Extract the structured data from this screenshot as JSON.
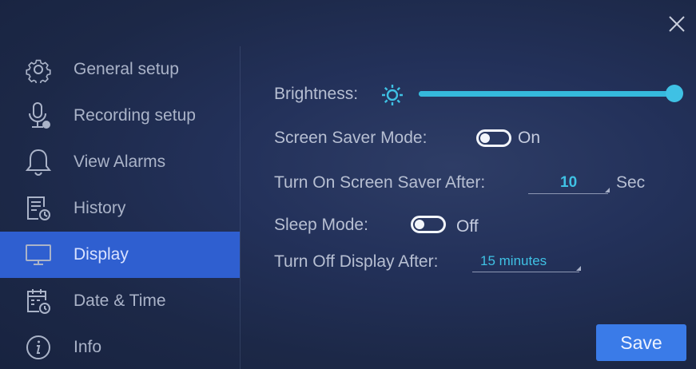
{
  "sidebar": {
    "items": [
      {
        "label": "General setup",
        "icon": "gear-icon"
      },
      {
        "label": "Recording setup",
        "icon": "microphone-icon"
      },
      {
        "label": "View Alarms",
        "icon": "bell-icon"
      },
      {
        "label": "History",
        "icon": "history-icon"
      },
      {
        "label": "Display",
        "icon": "monitor-icon",
        "active": true
      },
      {
        "label": "Date & Time",
        "icon": "calendar-clock-icon"
      },
      {
        "label": "Info",
        "icon": "info-icon"
      }
    ]
  },
  "display": {
    "brightness_label": "Brightness:",
    "brightness_level_percent": 100,
    "screen_saver_label": "Screen Saver Mode:",
    "screen_saver_state": "On",
    "screen_saver_after_label": "Turn On Screen Saver After:",
    "screen_saver_after_value": "10",
    "screen_saver_after_unit": "Sec",
    "sleep_mode_label": "Sleep Mode:",
    "sleep_mode_state": "Off",
    "display_off_label": "Turn Off Display After:",
    "display_off_value": "15 minutes"
  },
  "actions": {
    "save_label": "Save"
  },
  "colors": {
    "accent": "#3fc1e4",
    "active_nav": "#2f5fd0",
    "save_button": "#3a7be8"
  }
}
